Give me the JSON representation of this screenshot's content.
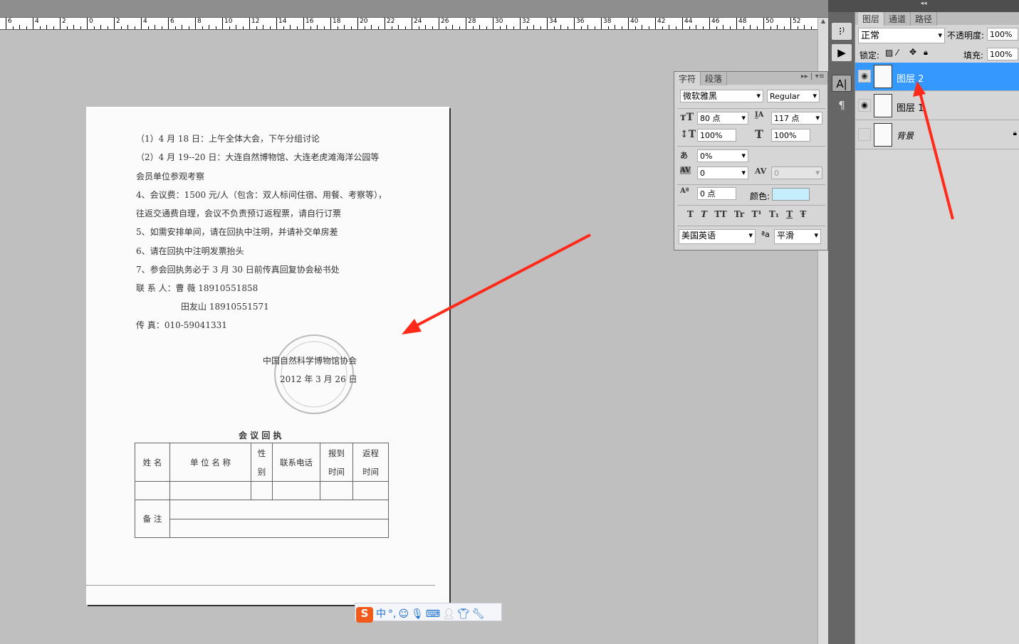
{
  "ruler": {
    "labels": [
      "6",
      "4",
      "2",
      "0",
      "2",
      "4",
      "6",
      "8",
      "10",
      "12",
      "14",
      "16",
      "18",
      "20",
      "22",
      "24",
      "26",
      "28",
      "30",
      "32",
      "34",
      "36",
      "38",
      "40",
      "42",
      "44",
      "46",
      "48",
      "50",
      "52",
      "5"
    ]
  },
  "document": {
    "lines": [
      "（1）4 月 18 日：上午全体大会，下午分组讨论",
      "（2）4 月 19--20 日：大连自然博物馆、大连老虎滩海洋公园等",
      "会员单位参观考察",
      "4、会议费：1500 元/人（包含：双人标间住宿、用餐、考察等），",
      "往返交通费自理，会议不负责预订返程票，请自行订票",
      "5、如需安排单间，请在回执中注明，并请补交单房差",
      "6、请在回执中注明发票抬头",
      "7、参会回执务必于 3 月 30 日前传真回复协会秘书处",
      "联 系 人：曹    薇  18910551858",
      "田友山  18910551571",
      "传      真：010-59041331"
    ],
    "org": "中国自然科学博物馆协会",
    "date": "2012 年 3 月 26 日",
    "stamp_text": "中国自然科学博物馆协会",
    "form_title": "会 议 回 执",
    "form_headers": [
      "姓 名",
      "单 位 名 称",
      "性\n别",
      "联系电话",
      "报到\n时间",
      "返程\n时间"
    ],
    "remarks_label": "备 注"
  },
  "character_panel": {
    "tabs": [
      "字符",
      "段落"
    ],
    "font_family": "微软雅黑",
    "font_style": "Regular",
    "font_size": "80 点",
    "leading": "117 点",
    "vertical_scale": "100%",
    "horizontal_scale": "100%",
    "tsume": "0%",
    "kerning": "0",
    "tracking": "0",
    "baseline_shift": "0 点",
    "color_label": "颜色:",
    "color": "#c4eefc",
    "style_buttons": [
      "T",
      "T",
      "TT",
      "Tr",
      "T¹",
      "T₁",
      "T",
      "Ŧ"
    ],
    "language": "美国英语",
    "antialias_icon": "ªa",
    "antialias": "平滑"
  },
  "layers_panel": {
    "tabs": [
      "图层",
      "通道",
      "路径"
    ],
    "blend_mode": "正常",
    "opacity_label": "不透明度:",
    "opacity": "100%",
    "lock_label": "锁定:",
    "fill_label": "填充:",
    "fill": "100%",
    "layers": [
      {
        "name": "图层 2",
        "visible": true,
        "selected": true
      },
      {
        "name": "图层 1",
        "visible": true,
        "selected": false
      },
      {
        "name": "背景",
        "visible": false,
        "selected": false,
        "locked": true
      }
    ],
    "selected_color": "#3399ff"
  },
  "ime_toolbar": {
    "logo": "S",
    "mode": "中",
    "punct": "°,"
  },
  "annotation_color": "#ff2a1a"
}
